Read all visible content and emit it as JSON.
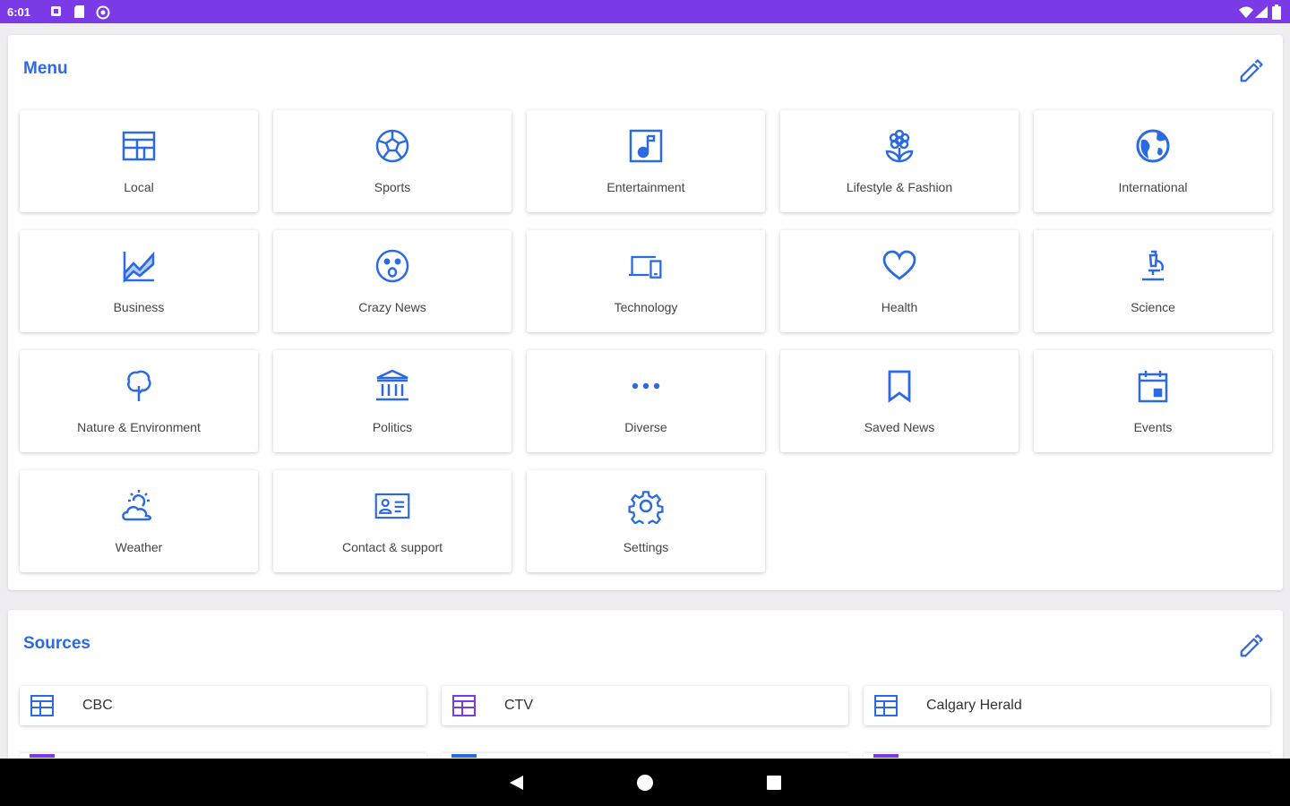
{
  "status_bar": {
    "time": "6:01"
  },
  "menu": {
    "title": "Menu",
    "items": [
      {
        "label": "Local",
        "icon": "newspaper-icon"
      },
      {
        "label": "Sports",
        "icon": "soccer-ball-icon"
      },
      {
        "label": "Entertainment",
        "icon": "music-note-icon"
      },
      {
        "label": "Lifestyle & Fashion",
        "icon": "flower-icon"
      },
      {
        "label": "International",
        "icon": "globe-icon"
      },
      {
        "label": "Business",
        "icon": "chart-icon"
      },
      {
        "label": "Crazy News",
        "icon": "surprised-face-icon"
      },
      {
        "label": "Technology",
        "icon": "devices-icon"
      },
      {
        "label": "Health",
        "icon": "heart-icon"
      },
      {
        "label": "Science",
        "icon": "microscope-icon"
      },
      {
        "label": "Nature & Environment",
        "icon": "tree-icon"
      },
      {
        "label": "Politics",
        "icon": "bank-icon"
      },
      {
        "label": "Diverse",
        "icon": "more-dots-icon"
      },
      {
        "label": "Saved News",
        "icon": "bookmark-icon"
      },
      {
        "label": "Events",
        "icon": "calendar-icon"
      },
      {
        "label": "Weather",
        "icon": "partly-cloudy-icon"
      },
      {
        "label": "Contact & support",
        "icon": "contact-card-icon"
      },
      {
        "label": "Settings",
        "icon": "gear-icon"
      }
    ]
  },
  "sources": {
    "title": "Sources",
    "items": [
      {
        "label": "CBC",
        "icon": "newspaper-icon",
        "color": "#2b6ae0"
      },
      {
        "label": "CTV",
        "icon": "newspaper-icon",
        "color": "#7a3be6"
      },
      {
        "label": "Calgary Herald",
        "icon": "newspaper-icon",
        "color": "#2b6ae0"
      }
    ]
  },
  "colors": {
    "accent": "#2b6ae0",
    "status_bar": "#7a3be6",
    "nav_bar": "#000000"
  }
}
